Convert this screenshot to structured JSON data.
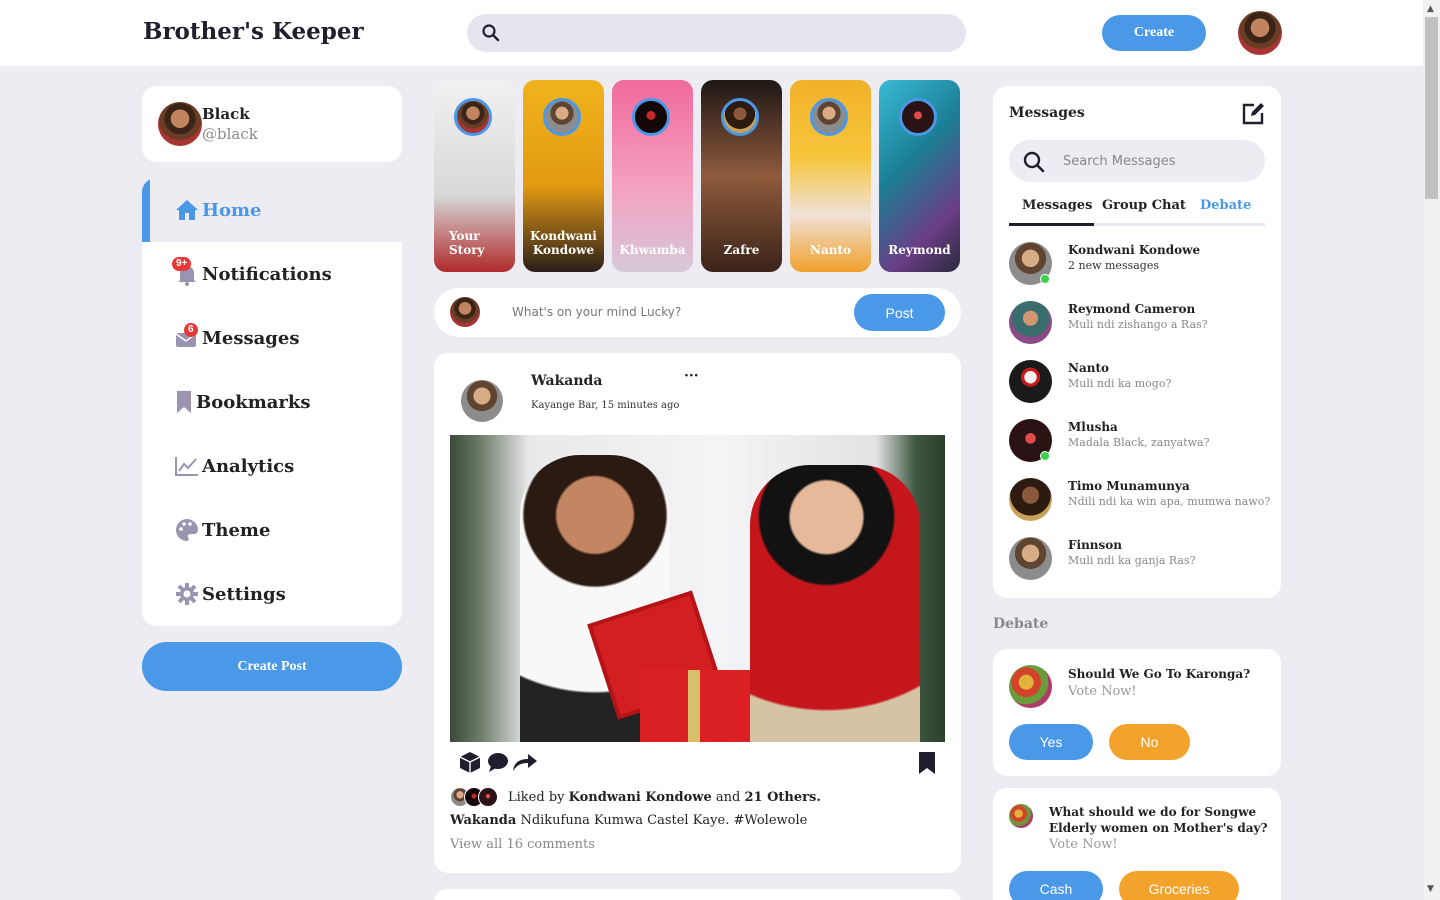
{
  "app": {
    "title": "Brother's Keeper",
    "create_label": "Create"
  },
  "user": {
    "name": "Black",
    "handle": "@black"
  },
  "sidebar": {
    "items": [
      {
        "label": "Home",
        "icon": "home-icon",
        "active": true
      },
      {
        "label": "Notifications",
        "icon": "bell-icon",
        "badge": "9+"
      },
      {
        "label": "Messages",
        "icon": "envelope-icon",
        "badge": "6"
      },
      {
        "label": "Bookmarks",
        "icon": "bookmark-icon"
      },
      {
        "label": "Analytics",
        "icon": "chart-line-icon"
      },
      {
        "label": "Theme",
        "icon": "palette-icon"
      },
      {
        "label": "Settings",
        "icon": "gear-icon"
      }
    ],
    "create_post_label": "Create Post"
  },
  "stories": [
    {
      "name": "Your Story"
    },
    {
      "name": "Kondwani Kondowe"
    },
    {
      "name": "Khwamba"
    },
    {
      "name": "Zafre"
    },
    {
      "name": "Nanto"
    },
    {
      "name": "Reymond"
    }
  ],
  "composer": {
    "placeholder": "What's on your mind Lucky?",
    "post_label": "Post"
  },
  "feed": {
    "user": "Wakanda",
    "meta": "Kayange Bar, 15 minutes ago",
    "more": "···",
    "liked_prefix": "Liked by",
    "liked_user": "Kondwani Kondowe",
    "liked_and": "and",
    "liked_others": "21 Others.",
    "caption_user": "Wakanda",
    "caption_text": "Ndikufuna Kumwa Castel Kaye. #Wolewole",
    "comments": "View all 16 comments"
  },
  "messages": {
    "title": "Messages",
    "search_placeholder": "Search Messages",
    "tabs": [
      "Messages",
      "Group Chat",
      "Debate"
    ],
    "conversations": [
      {
        "name": "Kondwani Kondowe",
        "text": "2 new messages",
        "online": true
      },
      {
        "name": "Reymond Cameron",
        "text": "Muli ndi zishango a Ras?",
        "online": false
      },
      {
        "name": "Nanto",
        "text": "Muli ndi ka mogo?",
        "online": false
      },
      {
        "name": "Mlusha",
        "text": "Madala Black, zanyatwa?",
        "online": true
      },
      {
        "name": "Timo Munamunya",
        "text": "Ndili ndi ka win apa, mumwa nawo?",
        "online": false
      },
      {
        "name": "Finnson",
        "text": "Muli ndi ka ganja Ras?",
        "online": false
      }
    ]
  },
  "debate": {
    "heading": "Debate",
    "polls": [
      {
        "question": "Should We Go To Karonga?",
        "vote": "Vote Now!",
        "options": [
          "Yes",
          "No"
        ]
      },
      {
        "question_line1": "What should we do for Songwe",
        "question_line2": "Elderly women on Mother's day?",
        "vote": "Vote Now!",
        "options": [
          "Cash",
          "Groceries"
        ]
      }
    ]
  },
  "colors": {
    "accent": "#4a98e8",
    "secondary": "#f3a32b",
    "background": "#ececf2",
    "badge": "#e53935",
    "online": "#3ad24a"
  }
}
